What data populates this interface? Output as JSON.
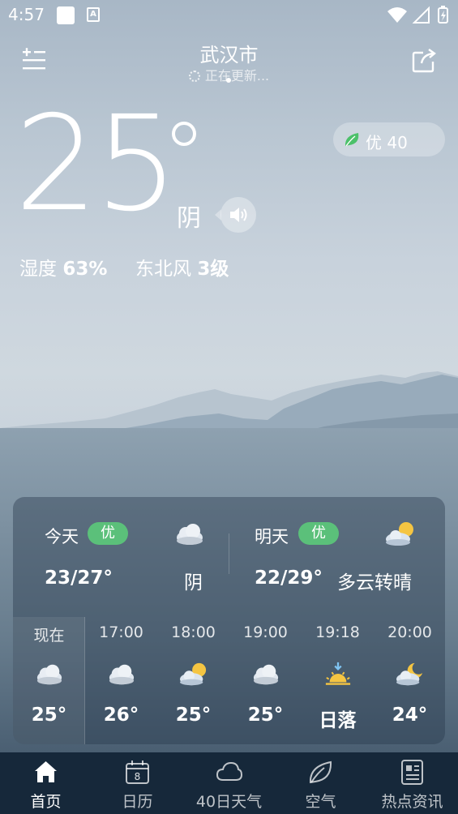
{
  "status_bar": {
    "time": "4:57",
    "a_icon": "A"
  },
  "header": {
    "city": "武汉市",
    "update_status": "正在更新..."
  },
  "current": {
    "temperature": "25",
    "condition": "阴",
    "aqi_label": "优 40",
    "humidity_label": "湿度",
    "humidity_value": "63%",
    "wind_label": "东北风",
    "wind_value": "3级"
  },
  "forecast": {
    "today": {
      "label": "今天",
      "badge": "优",
      "range": "23/27°",
      "condition": "阴",
      "icon": "cloudy-icon"
    },
    "tomorrow": {
      "label": "明天",
      "badge": "优",
      "range": "22/29°",
      "condition": "多云转晴",
      "icon": "partly-sunny-icon"
    }
  },
  "hourly": [
    {
      "time": "现在",
      "value": "25°",
      "icon": "cloudy-icon"
    },
    {
      "time": "17:00",
      "value": "26°",
      "icon": "cloudy-icon"
    },
    {
      "time": "18:00",
      "value": "25°",
      "icon": "partly-sunny-icon"
    },
    {
      "time": "19:00",
      "value": "25°",
      "icon": "cloudy-icon"
    },
    {
      "time": "19:18",
      "value": "日落",
      "icon": "sunset-icon"
    },
    {
      "time": "20:00",
      "value": "24°",
      "icon": "partly-cloudy-night-icon"
    }
  ],
  "nav": [
    {
      "label": "首页",
      "icon": "home-icon",
      "active": true
    },
    {
      "label": "日历",
      "icon": "calendar-icon",
      "calendar_day": "8"
    },
    {
      "label": "40日天气",
      "icon": "cloud-outline-icon"
    },
    {
      "label": "空气",
      "icon": "leaf-icon"
    },
    {
      "label": "热点资讯",
      "icon": "news-icon"
    }
  ],
  "colors": {
    "badge_green": "#5bc07a",
    "nav_bg": "#16283a",
    "leaf_green": "#4cc16a",
    "sun_yellow": "#f5c542"
  }
}
